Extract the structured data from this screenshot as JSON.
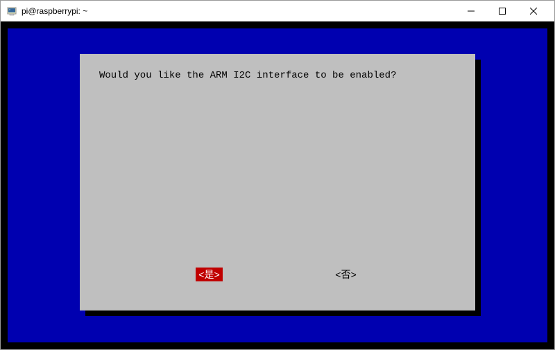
{
  "window": {
    "title": "pi@raspberrypi: ~"
  },
  "dialog": {
    "message": "Would you like the ARM I2C interface to be enabled?",
    "yes_label": "<是>",
    "no_label": "<否>"
  }
}
